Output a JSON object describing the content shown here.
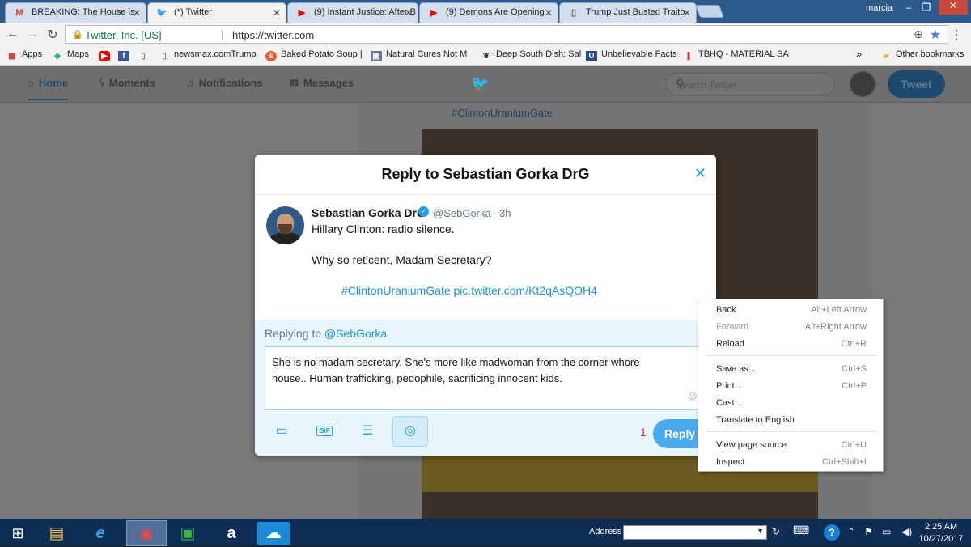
{
  "browser": {
    "tabs": [
      {
        "label": "BREAKING: The House is",
        "icon": "gmail-icon"
      },
      {
        "label": "(*) Twitter",
        "icon": "twitter-icon"
      },
      {
        "label": "(9) Instant Justice: After B",
        "icon": "youtube-icon"
      },
      {
        "label": "(9) Demons Are Opening",
        "icon": "youtube-icon"
      },
      {
        "label": "Trump Just Busted Traito",
        "icon": "page-icon"
      }
    ],
    "profile_name": "marcia",
    "site_identity": "Twitter, Inc. [US]",
    "url": "https://twitter.com",
    "bookmarks": [
      {
        "label": "Apps",
        "icon": "apps-icon"
      },
      {
        "label": "Maps",
        "icon": "maps-icon"
      },
      {
        "label": "",
        "icon": "youtube-icon"
      },
      {
        "label": "",
        "icon": "facebook-icon"
      },
      {
        "label": "",
        "icon": "page-icon"
      },
      {
        "label": "newsmax.comTrump",
        "icon": "page-icon"
      },
      {
        "label": "Baked Potato Soup |",
        "icon": "stumble-icon"
      },
      {
        "label": "Natural Cures Not M",
        "icon": "natural-icon"
      },
      {
        "label": "Deep South Dish: Sal",
        "icon": "leaf-icon"
      },
      {
        "label": "Unbelievable Facts",
        "icon": "uf-icon"
      },
      {
        "label": "TBHQ - MATERIAL SA",
        "icon": "tbhq-icon"
      }
    ],
    "bookmarks_overflow": "»",
    "other_bookmarks": "Other bookmarks"
  },
  "twitter": {
    "nav": {
      "home": "Home",
      "moments": "Moments",
      "notifications": "Notifications",
      "messages": "Messages",
      "search_placeholder": "Search Twitter",
      "tweet_button": "Tweet"
    },
    "feed_hashtag": "#ClintonUraniumGate"
  },
  "modal": {
    "title": "Reply to Sebastian Gorka DrG",
    "tweet": {
      "name": "Sebastian Gorka DrG",
      "handle": "@SebGorka",
      "dot": "·",
      "time": "3h",
      "line1": "Hillary Clinton: radio silence.",
      "line2": "Why so reticent, Madam Secretary?",
      "link": "#ClintonUraniumGate pic.twitter.com/Kt2qAsQOH4"
    },
    "replying_prefix": "Replying to",
    "replying_handle": "@SebGorka",
    "reply_text": "She is no madam secretary. She's more like madwoman from the corner whore house.. Human trafficking, pedophile, sacrificing innocent kids.",
    "char_count": "1",
    "reply_button": "Reply"
  },
  "context_menu": {
    "back": {
      "label": "Back",
      "shortcut": "Alt+Left Arrow"
    },
    "forward": {
      "label": "Forward",
      "shortcut": "Alt+Right Arrow"
    },
    "reload": {
      "label": "Reload",
      "shortcut": "Ctrl+R"
    },
    "save_as": {
      "label": "Save as...",
      "shortcut": "Ctrl+S"
    },
    "print": {
      "label": "Print...",
      "shortcut": "Ctrl+P"
    },
    "cast": {
      "label": "Cast...",
      "shortcut": ""
    },
    "translate": {
      "label": "Translate to English",
      "shortcut": ""
    },
    "view_source": {
      "label": "View page source",
      "shortcut": "Ctrl+U"
    },
    "inspect": {
      "label": "Inspect",
      "shortcut": "Ctrl+Shift+I"
    }
  },
  "taskbar": {
    "address_label": "Address",
    "time": "2:25 AM",
    "date": "10/27/2017"
  },
  "colors": {
    "twitter_blue": "#1da1f2",
    "reply_button": "#4aaaf0",
    "char_count_red": "#e0245e"
  }
}
